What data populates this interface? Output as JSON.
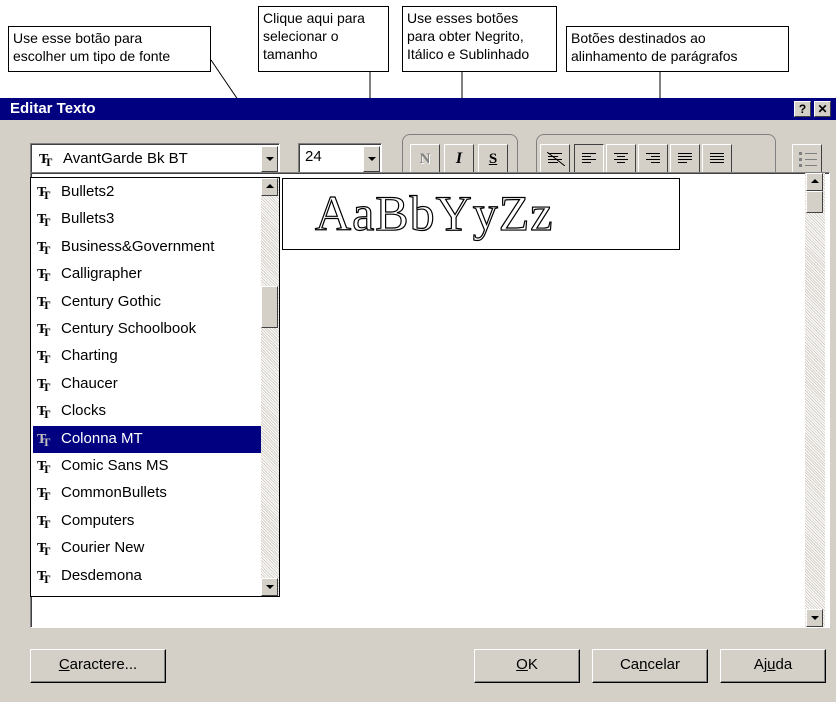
{
  "callouts": {
    "font": "Use esse botão para\nescolher um tipo de fonte",
    "size": "Clique aqui para\nselecionar o\ntamanho",
    "style": "Use esses botões\npara obter Negrito,\nItálico e Sublinhado",
    "align": "Botões destinados ao\nalinhamento de parágrafos"
  },
  "dialog": {
    "title": "Editar Texto",
    "help_btn": "?",
    "close_btn": "✕"
  },
  "font_combo": {
    "value": "AvantGarde Bk BT"
  },
  "size_combo": {
    "value": "24"
  },
  "style_buttons": {
    "bold": "N",
    "italic": "I",
    "underline": "S"
  },
  "font_list": [
    "Bullets2",
    "Bullets3",
    "Business&Government",
    "Calligrapher",
    "Century Gothic",
    "Century Schoolbook",
    "Charting",
    "Chaucer",
    "Clocks",
    "Colonna MT",
    "Comic Sans MS",
    "CommonBullets",
    "Computers",
    "Courier New",
    "Desdemona"
  ],
  "font_list_selected": "Colonna MT",
  "preview": {
    "sample": "AaBbYyZz"
  },
  "buttons": {
    "caractere": "Caractere...",
    "ok": "OK",
    "cancelar": "Cancelar",
    "ajuda": "Ajuda"
  },
  "icons": {
    "truetype": "tt-icon",
    "list": "bullets-icon"
  }
}
